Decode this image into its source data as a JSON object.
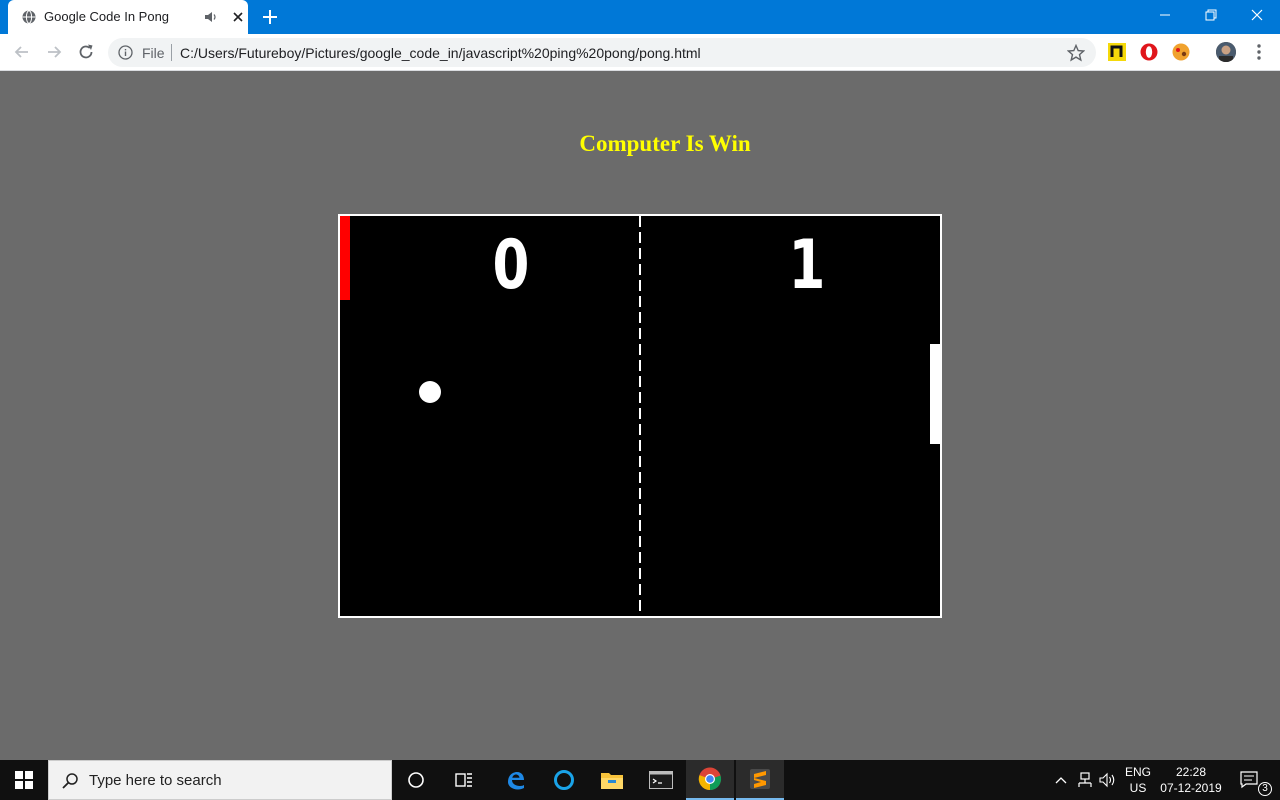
{
  "browser": {
    "tab_title": "Google Code In Pong",
    "omnibox_scheme_label": "File",
    "url": "C:/Users/Futureboy/Pictures/google_code_in/javascript%20ping%20pong/pong.html",
    "icons": {
      "favicon": "globe-icon",
      "audio": "speaker-icon",
      "close_tab": "close-icon",
      "new_tab": "plus-icon",
      "back": "arrow-left-icon",
      "forward": "arrow-right-icon",
      "reload": "reload-icon",
      "site_info": "info-icon",
      "bookmark": "star-icon",
      "menu": "kebab-menu-icon"
    },
    "accent_color": "#0078d7"
  },
  "game": {
    "status_message": "Computer Is Win",
    "status_color": "#ffff00",
    "score_left": "0",
    "score_right": "1",
    "left_paddle_color": "#ff0000",
    "right_paddle_color": "#ffffff",
    "ball_color": "#ffffff",
    "background_color": "#000000"
  },
  "taskbar": {
    "search_placeholder": "Type here to search",
    "language_top": "ENG",
    "language_bottom": "US",
    "time": "22:28",
    "date": "07-12-2019",
    "notification_count": "3",
    "apps": [
      "cortana-icon",
      "task-view-icon",
      "edge-icon",
      "cortana-circle-icon",
      "file-explorer-icon",
      "terminal-icon",
      "chrome-icon",
      "sublime-text-icon"
    ]
  }
}
